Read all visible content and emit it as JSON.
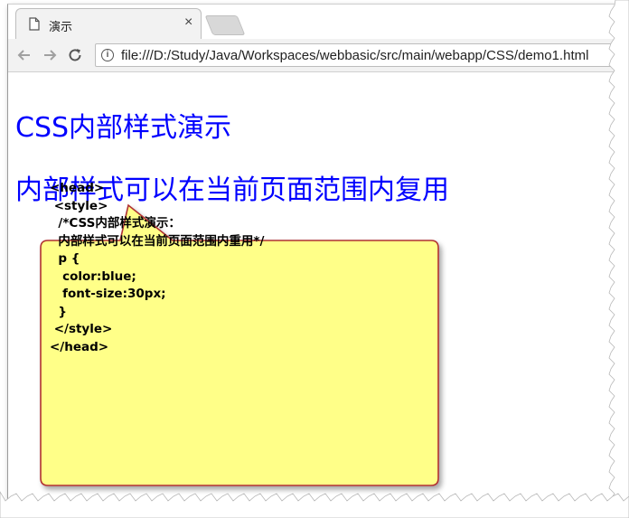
{
  "browser": {
    "tab_title": "演示",
    "tab_close": "×",
    "url": "file:///D:/Study/Java/Workspaces/webbasic/src/main/webapp/CSS/demo1.html",
    "info_glyph": "i",
    "icons": {
      "back": "back-arrow-icon",
      "forward": "forward-arrow-icon",
      "reload": "reload-icon",
      "page": "document-icon"
    }
  },
  "page": {
    "para1": "CSS内部样式演示",
    "para2": "内部样式可以在当前页面范围内复用",
    "text_color": "#0000ff"
  },
  "callout": {
    "fill": "#ffff88",
    "border": "#b03030",
    "lines": [
      "<head>",
      " <style>",
      "  /*CSS内部样式演示：",
      "  内部样式可以在当前页面范围内重用*/",
      "  p {",
      "   color:blue;",
      "   font-size:30px;",
      "  }",
      " </style>",
      "</head>"
    ]
  }
}
